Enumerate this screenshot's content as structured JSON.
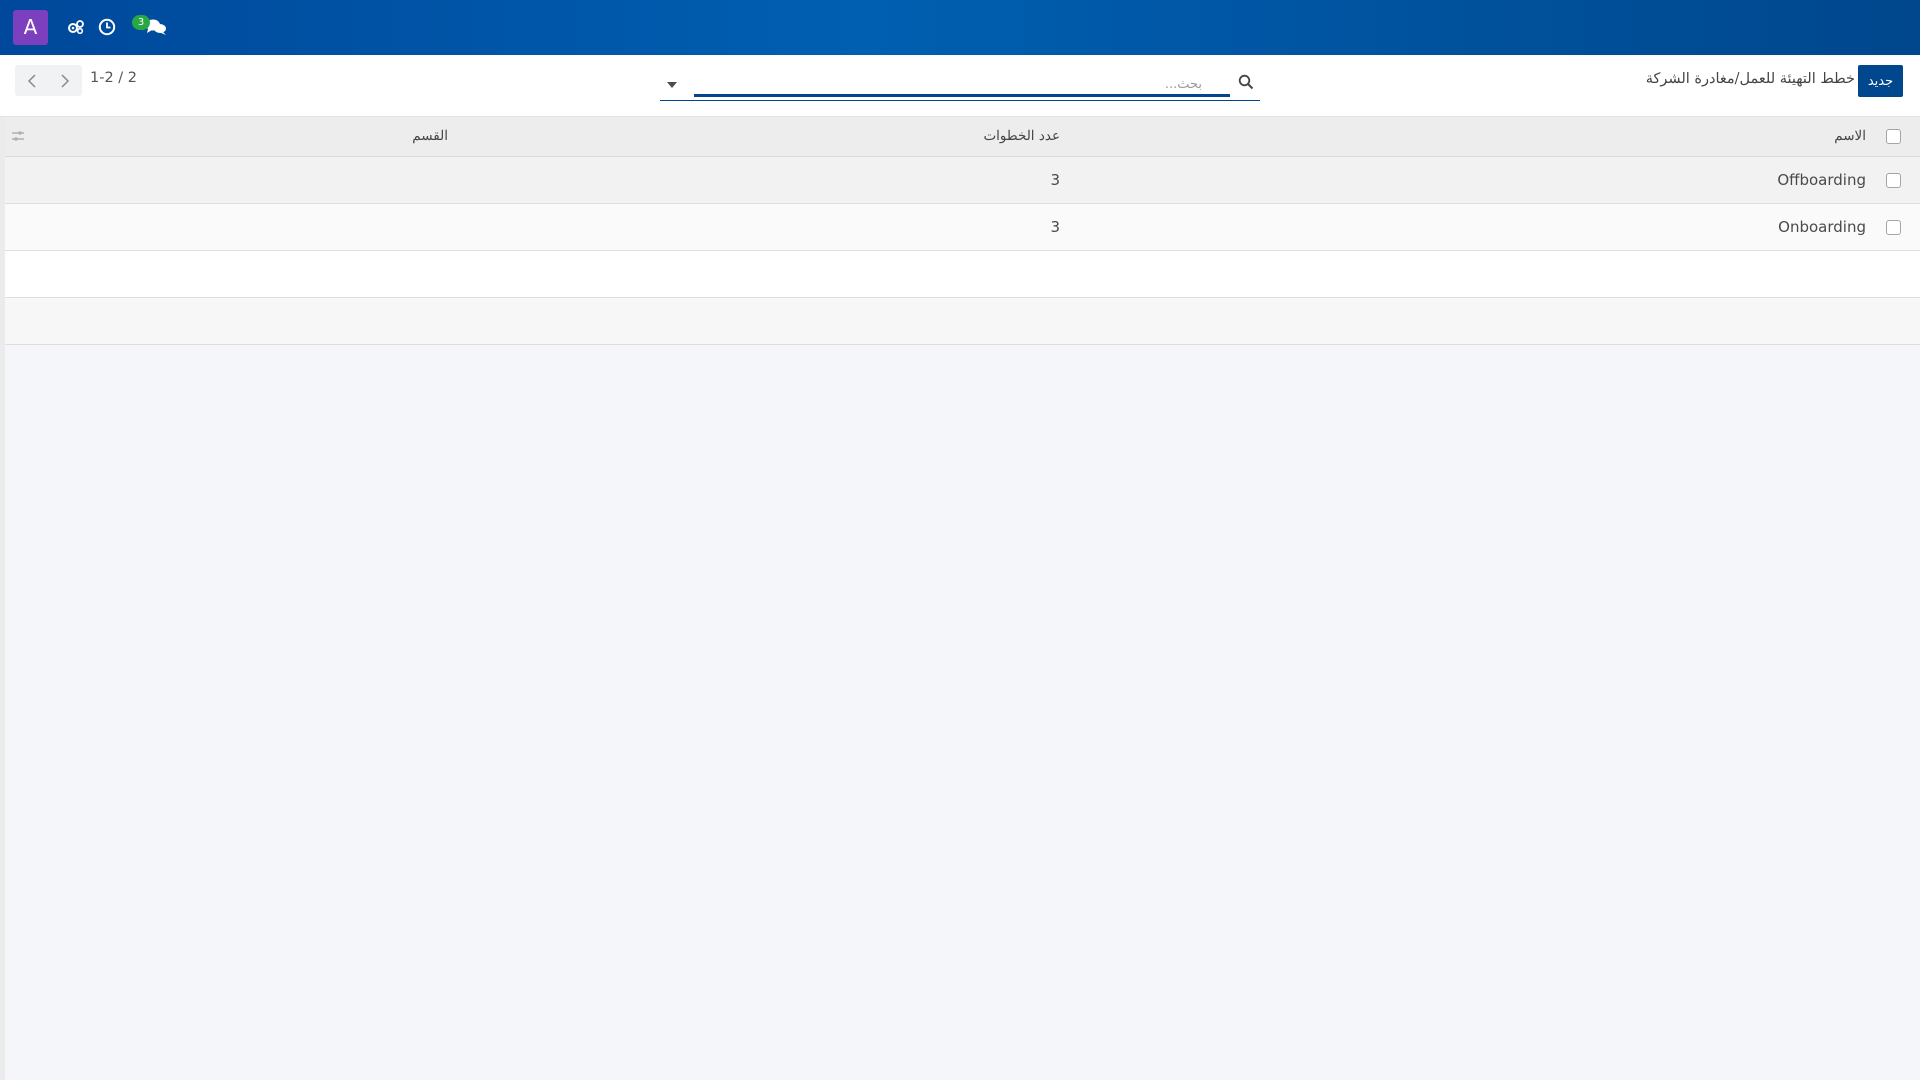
{
  "navbar": {
    "avatar_letter": "A",
    "icons": [
      "settings-gears-icon",
      "clock-icon",
      "chat-icon"
    ],
    "chat_badge": "3",
    "colors": {
      "bar": "#00489b",
      "avatar": "#7c3fbe",
      "badge": "#28a745"
    }
  },
  "control_panel": {
    "new_button_label": "جديد",
    "breadcrumb": "خطط التهيئة للعمل/مغادرة الشركة",
    "search_placeholder": "بحث...",
    "pager_text": "1-2 / 2"
  },
  "table": {
    "columns": [
      "الاسم",
      "عدد الخطوات",
      "القسم"
    ],
    "rows": [
      {
        "name": "Offboarding",
        "steps": "3",
        "department": ""
      },
      {
        "name": "Onboarding",
        "steps": "3",
        "department": ""
      }
    ]
  },
  "colors": {
    "primary": "#00478d"
  }
}
